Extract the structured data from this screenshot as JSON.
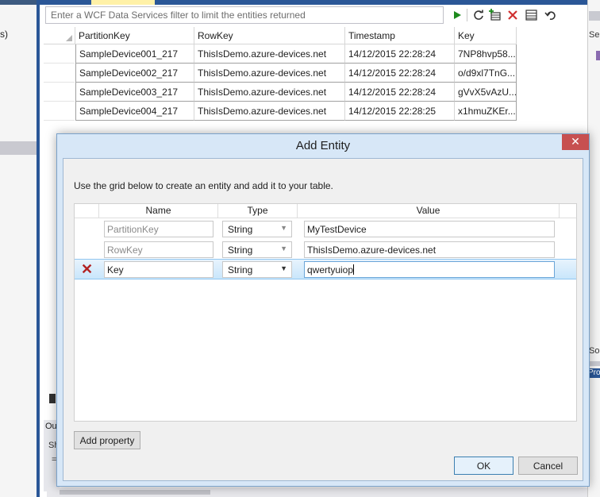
{
  "left_panel": {
    "text": "s)"
  },
  "filter": {
    "placeholder": "Enter a WCF Data Services filter to limit the entities returned"
  },
  "grid": {
    "columns": [
      "PartitionKey",
      "RowKey",
      "Timestamp",
      "Key"
    ],
    "rows": [
      [
        "SampleDevice001_217",
        "ThisIsDemo.azure-devices.net",
        "14/12/2015 22:28:24",
        "7NP8hvp58..."
      ],
      [
        "SampleDevice002_217",
        "ThisIsDemo.azure-devices.net",
        "14/12/2015 22:28:24",
        "o/d9xl7TnG..."
      ],
      [
        "SampleDevice003_217",
        "ThisIsDemo.azure-devices.net",
        "14/12/2015 22:28:24",
        "gVvX5vAzU..."
      ],
      [
        "SampleDevice004_217",
        "ThisIsDemo.azure-devices.net",
        "14/12/2015 22:28:25",
        "x1hmuZKEr..."
      ]
    ]
  },
  "right_panel": {
    "text_1": "Se",
    "text_2": "So",
    "text_3": "Pro"
  },
  "bottom_pane": {
    "tab_label": "Ou",
    "line_1": "Sh",
    "line_2": "="
  },
  "dialog": {
    "title": "Add Entity",
    "close_glyph": "✕",
    "instruction": "Use the grid below to create an entity and add it to your table.",
    "columns": {
      "name": "Name",
      "type": "Type",
      "value": "Value"
    },
    "properties": [
      {
        "name": "PartitionKey",
        "type": "String",
        "value": "MyTestDevice"
      },
      {
        "name": "RowKey",
        "type": "String",
        "value": "ThisIsDemo.azure-devices.net"
      },
      {
        "name": "Key",
        "type": "String",
        "value": "qwertyuiop"
      }
    ],
    "add_property_label": "Add property",
    "ok_label": "OK",
    "cancel_label": "Cancel"
  }
}
